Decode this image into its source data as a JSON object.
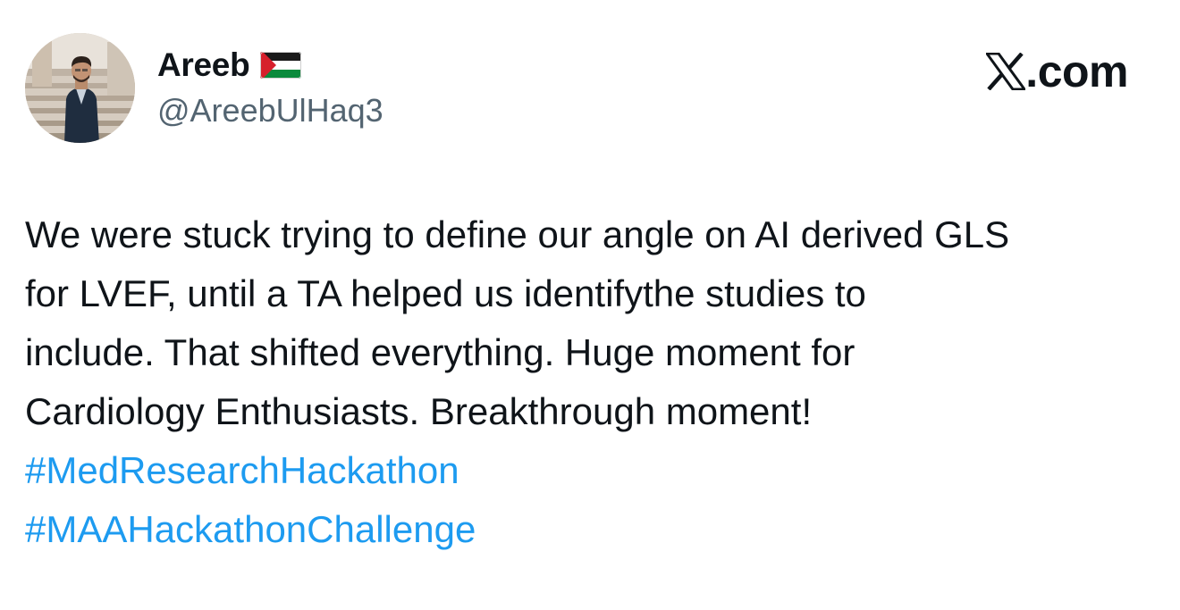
{
  "author": {
    "display_name": "Areeb",
    "handle": "@AreebUlHaq3",
    "avatar_icon": "profile-photo",
    "badge_icon": "palestine-flag-icon"
  },
  "brand": {
    "logo_icon": "x-logo-icon",
    "domain": ".com"
  },
  "tweet": {
    "lines": [
      "We were stuck trying to define our angle on AI derived GLS",
      "for LVEF, until a TA helped us identifythe studies to",
      "include. That shifted everything. Huge moment for",
      "Cardiology Enthusiasts. Breakthrough moment!"
    ],
    "hashtags": [
      "#MedResearchHackathon",
      "#MAAHackathonChallenge"
    ]
  },
  "colors": {
    "text": "#0f1419",
    "secondary_text": "#536471",
    "link": "#1d9bf0",
    "background": "#ffffff"
  }
}
